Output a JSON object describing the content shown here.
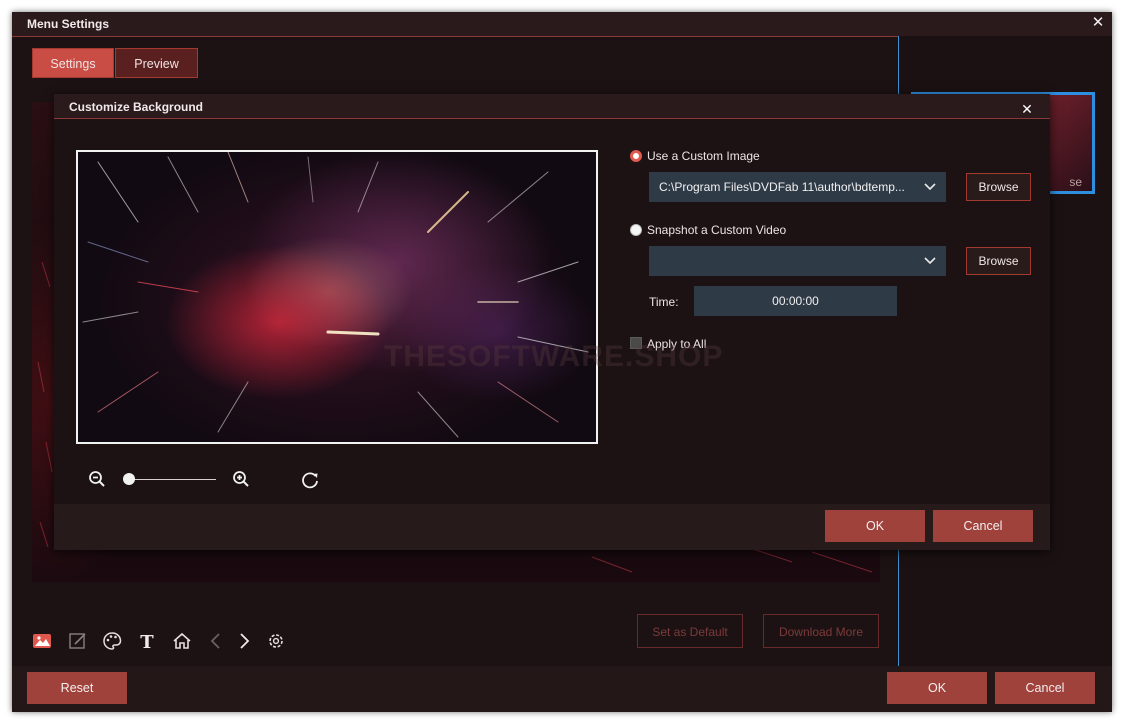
{
  "window": {
    "title": "Menu Settings"
  },
  "tabs": [
    {
      "label": "Settings",
      "active": true
    },
    {
      "label": "Preview",
      "active": false
    }
  ],
  "view_icons": [
    "list-view-icon",
    "grid-view-icon"
  ],
  "thumbnail": {
    "caption": "se"
  },
  "background_actions": {
    "set_default": "Set as Default",
    "download_more": "Download More"
  },
  "toolbar_icons": [
    "image-icon",
    "edit-icon",
    "palette-icon",
    "text-icon",
    "home-icon",
    "chevron-left-icon",
    "chevron-right-icon",
    "settings-icon"
  ],
  "bottom": {
    "reset": "Reset",
    "ok": "OK",
    "cancel": "Cancel"
  },
  "dialog": {
    "title": "Customize Background",
    "use_custom_image": {
      "label": "Use a Custom Image",
      "selected": true,
      "path": "C:\\Program Files\\DVDFab 11\\author\\bdtemp...",
      "browse": "Browse"
    },
    "snapshot_video": {
      "label": "Snapshot a Custom Video",
      "selected": false,
      "path": "",
      "browse": "Browse"
    },
    "time": {
      "label": "Time:",
      "value": "00:00:00"
    },
    "apply_to_all": {
      "label": "Apply to All",
      "checked": false
    },
    "watermark": "THESOFTWARE.SHOP",
    "ok": "OK",
    "cancel": "Cancel"
  },
  "colors": {
    "accent": "#c94d44",
    "button": "#a0423c",
    "field": "#2f3a47",
    "selection": "#2e8fe0"
  }
}
